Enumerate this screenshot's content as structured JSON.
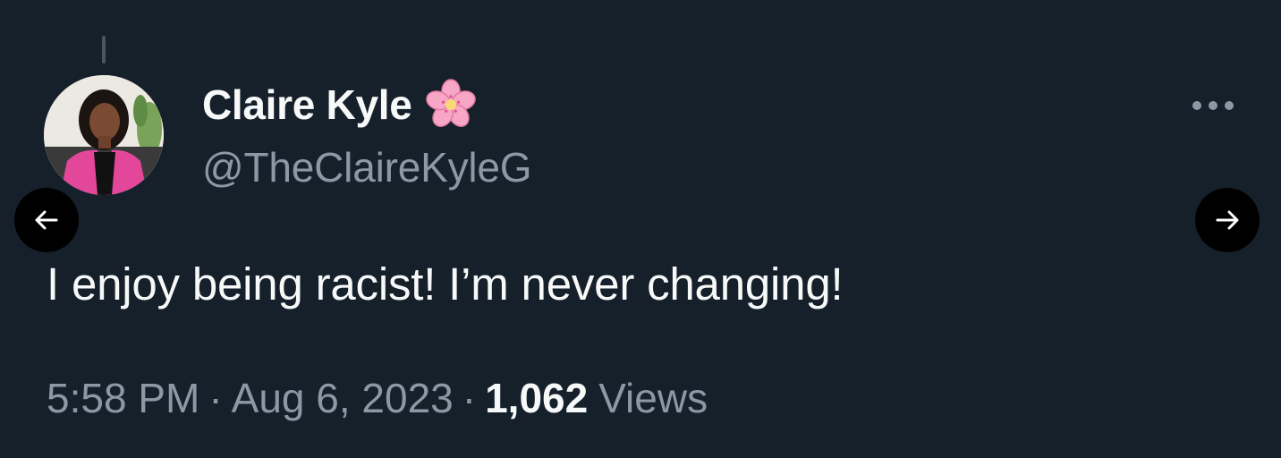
{
  "tweet": {
    "display_name": "Claire Kyle",
    "name_emoji_icon": "cherry-blossom-icon",
    "handle": "@TheClaireKyleG",
    "text": "I enjoy being racist! I’m never changing!",
    "time": "5:58 PM",
    "separator": "·",
    "date": "Aug 6, 2023",
    "views_count": "1,062",
    "views_label": "Views"
  },
  "icons": {
    "more": "more-horizontal-icon",
    "prev": "arrow-left-icon",
    "next": "arrow-right-icon"
  },
  "colors": {
    "background": "#15202b",
    "primary_text": "#f7f9f9",
    "secondary_text": "#8b98a5",
    "nav_button": "#000000",
    "flower_pink": "#f7a6c5"
  }
}
